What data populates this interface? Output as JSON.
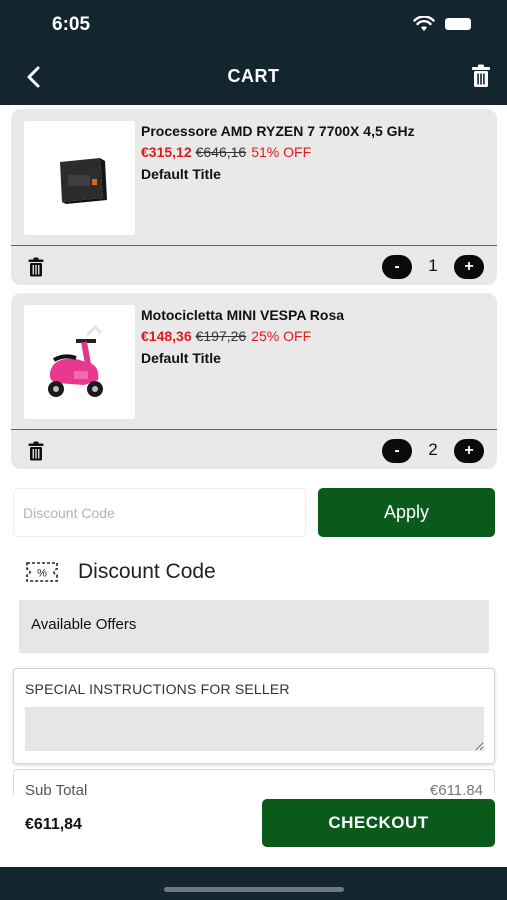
{
  "status_bar": {
    "time": "6:05"
  },
  "header": {
    "title": "CART"
  },
  "cart": {
    "items": [
      {
        "name": "Processore AMD RYZEN 7 7700X 4,5 GHz",
        "sale_price": "€315,12",
        "original_price": "€646,16",
        "discount": "51% OFF",
        "variant": "Default Title",
        "quantity": "1",
        "minus_label": "-",
        "plus_label": "+"
      },
      {
        "name": "Motocicletta MINI VESPA Rosa",
        "sale_price": "€148,36",
        "original_price": "€197,26",
        "discount": "25% OFF",
        "variant": "Default Title",
        "quantity": "2",
        "minus_label": "-",
        "plus_label": "+"
      }
    ]
  },
  "discount": {
    "placeholder": "Discount Code",
    "apply_label": "Apply",
    "heading": "Discount Code",
    "coupon_icon_text": "%",
    "offers_label": "Available Offers"
  },
  "instructions": {
    "title": "SPECIAL INSTRUCTIONS FOR SELLER"
  },
  "summary": {
    "subtotal_label": "Sub Total",
    "subtotal_value": "€611.84",
    "total": "€611,84",
    "checkout_label": "CHECKOUT"
  },
  "colors": {
    "header_bg": "#13252f",
    "accent_green": "#0a5a1c",
    "sale_red": "#e01b1b",
    "card_bg": "#e9e9e9"
  },
  "icons": [
    "back-arrow-icon",
    "trash-icon",
    "wifi-icon",
    "battery-icon",
    "coupon-icon",
    "minus-icon",
    "plus-icon"
  ]
}
